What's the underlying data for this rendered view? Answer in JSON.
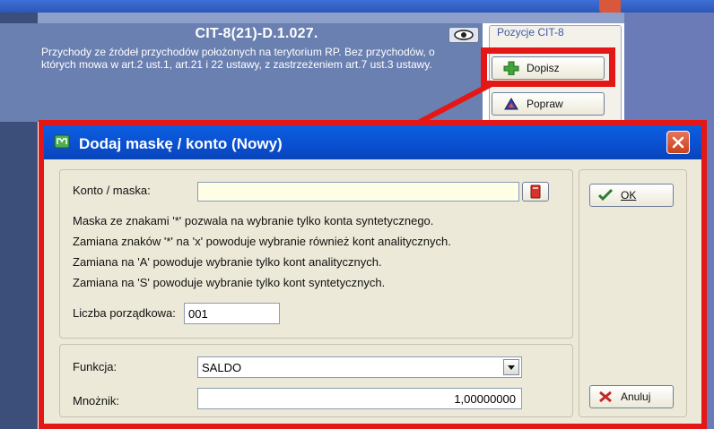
{
  "background": {
    "form_title": "CIT-8(21)-D.1.027.",
    "description": "Przychody ze źródeł przychodów położonych na terytorium RP. Bez przychodów, o których mowa w art.2 ust.1, art.21 i 22 ustawy, z zastrzeżeniem art.7 ust.3 ustawy.",
    "group_label": "Pozycje CIT-8",
    "add_button": "Dopisz",
    "edit_button": "Popraw"
  },
  "dialog": {
    "title": "Dodaj maskę / konto  (Nowy)",
    "konto_label": "Konto / maska:",
    "konto_value": "",
    "help": [
      "Maska ze znakami '*' pozwala na wybranie tylko konta syntetycznego.",
      "Zamiana znaków '*' na 'x' powoduje wybranie również kont analitycznych.",
      "Zamiana na 'A' powoduje wybranie tylko kont analitycznych.",
      "Zamiana na 'S' powoduje wybranie tylko kont syntetycznych."
    ],
    "lp_label": "Liczba porządkowa:",
    "lp_value": "001",
    "funkcja_label": "Funkcja:",
    "funkcja_value": "SALDO",
    "mnoznik_label": "Mnożnik:",
    "mnoznik_value": "1,00000000",
    "ok_label": "OK",
    "cancel_label": "Anuluj"
  },
  "colors": {
    "highlight": "#e51616",
    "titlebar": "#0a4fd0",
    "konto_field": "#fefde6"
  }
}
